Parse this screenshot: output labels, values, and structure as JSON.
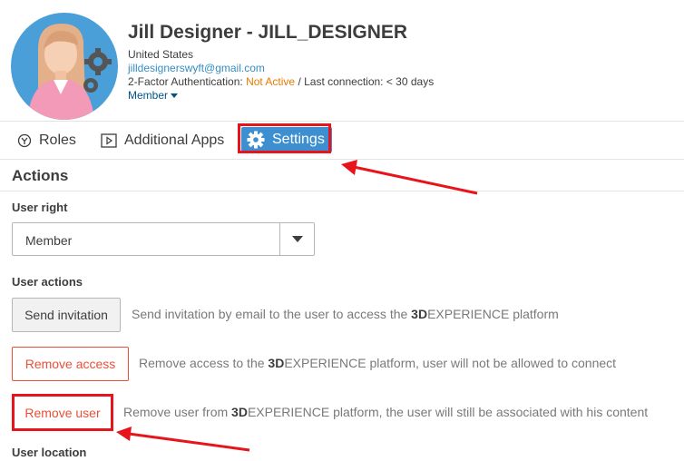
{
  "user": {
    "name": "Jill Designer - JILL_DESIGNER",
    "country": "United States",
    "email": "jilldesignerswyft@gmail.com",
    "twofa_prefix": "2-Factor Authentication: ",
    "twofa_status": "Not Active",
    "last_connection": " / Last connection: < 30 days",
    "role_menu": "Member"
  },
  "tabs": {
    "roles": "Roles",
    "apps": "Additional Apps",
    "settings": "Settings"
  },
  "actions": {
    "title": "Actions",
    "user_right_label": "User right",
    "user_right_value": "Member",
    "user_actions_label": "User actions",
    "send_invitation": {
      "label": "Send invitation",
      "desc_pre": "Send invitation by email to the user to access the ",
      "desc_brand": "3D",
      "desc_post": "EXPERIENCE platform"
    },
    "remove_access": {
      "label": "Remove access",
      "desc_pre": "Remove access to the ",
      "desc_brand": "3D",
      "desc_post": "EXPERIENCE platform, user will not be allowed to connect"
    },
    "remove_user": {
      "label": "Remove user",
      "desc_pre": "Remove user from ",
      "desc_brand": "3D",
      "desc_post": "EXPERIENCE platform, the user will still be associated with his content"
    },
    "user_location_label": "User location"
  },
  "colors": {
    "accent": "#3d8fd0",
    "danger": "#ea4f37",
    "annotation": "#e8141b",
    "warning": "#e87b00"
  },
  "icons": [
    "roles-icon",
    "apps-icon",
    "gear-icon",
    "dropdown-caret-icon",
    "avatar-image"
  ]
}
